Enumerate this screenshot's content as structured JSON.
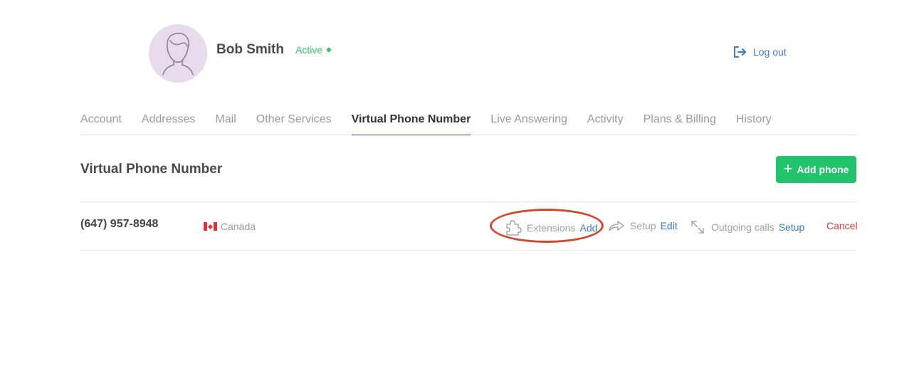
{
  "profile": {
    "name": "Bob Smith",
    "status": "Active",
    "status_color": "#2ec76b",
    "avatar_icon": "user-avatar-icon"
  },
  "header": {
    "logout_label": "Log out",
    "logout_icon": "logout-icon"
  },
  "tabs": [
    {
      "label": "Account"
    },
    {
      "label": "Addresses"
    },
    {
      "label": "Mail"
    },
    {
      "label": "Other Services"
    },
    {
      "label": "Virtual Phone Number",
      "active": true
    },
    {
      "label": "Live Answering"
    },
    {
      "label": "Activity"
    },
    {
      "label": "Plans & Billing"
    },
    {
      "label": "History"
    }
  ],
  "section": {
    "title": "Virtual Phone Number",
    "add_button_label": "Add phone",
    "add_button_color": "#22c46b"
  },
  "phone_row": {
    "number": "(647) 957-8948",
    "country": "Canada",
    "extensions_label": "Extensions",
    "extensions_action": "Add",
    "setup_label": "Setup",
    "setup_action": "Edit",
    "outgoing_label": "Outgoing calls",
    "outgoing_action": "Setup",
    "cancel_label": "Cancel"
  },
  "colors": {
    "accent_link": "#3a7bd5",
    "cancel": "#e0403a",
    "active_tab_underline": "#6b2f7a",
    "highlight_ring": "#d4452b"
  }
}
